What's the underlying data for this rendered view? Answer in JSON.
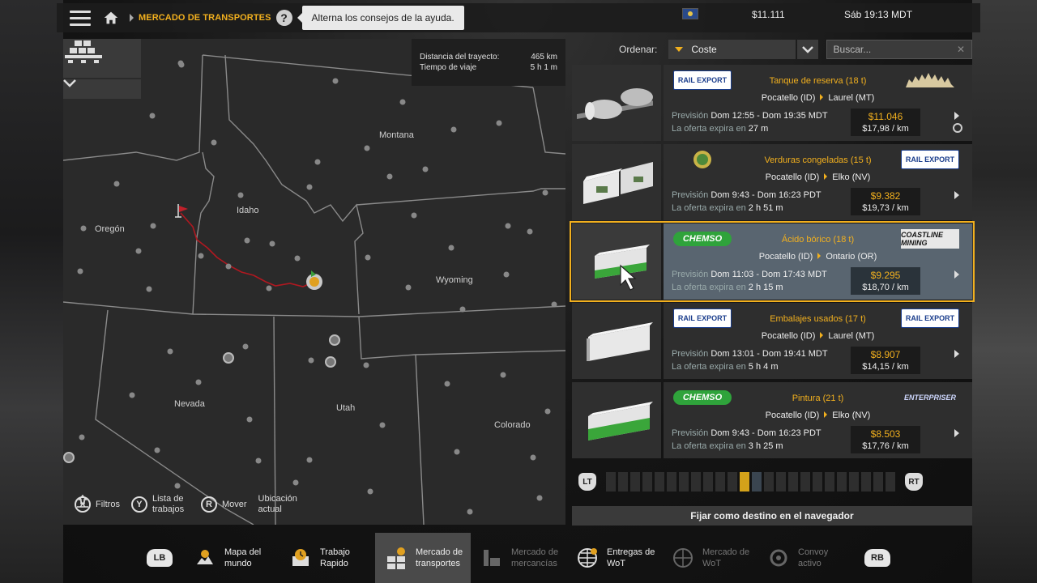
{
  "topbar": {
    "breadcrumb": "MERCADO DE TRANSPORTES",
    "help_label": "?",
    "tooltip": "Alterna los consejos de la ayuda.",
    "money": "$11.111",
    "clock": "Sáb 19:13 MDT"
  },
  "route_info": {
    "distance_label": "Distancia del trayecto:",
    "distance_value": "465 km",
    "time_label": "Tiempo de viaje",
    "time_value": "5 h 1 m"
  },
  "map": {
    "states": [
      "Montana",
      "Idaho",
      "Oregón",
      "Wyoming",
      "Nevada",
      "Utah",
      "Colorado"
    ],
    "controls": [
      {
        "key": "X",
        "label": "Filtros"
      },
      {
        "key": "Y",
        "label": "Lista de trabajos"
      },
      {
        "key": "R",
        "label": "Mover"
      },
      {
        "key": "",
        "label": "Ubicación actual"
      }
    ]
  },
  "sort": {
    "label": "Ordenar:",
    "value": "Coste",
    "search_placeholder": "Buscar..."
  },
  "jobs": [
    {
      "cargo": "Tanque de reserva (18 t)",
      "from": "Pocatello (ID)",
      "to": "Laurel (MT)",
      "forecast_label": "Previsión",
      "dates": "Dom 12:55 - Dom 19:35 MDT",
      "expires_label": "La oferta expira en",
      "expires": "27 m",
      "price": "$11.046",
      "per_km": "$17,98 / km",
      "logo_left": "RAIL EXPORT",
      "logo_right": "sawmill"
    },
    {
      "cargo": "Verduras congeladas (15 t)",
      "from": "Pocatello (ID)",
      "to": "Elko (NV)",
      "forecast_label": "Previsión",
      "dates": "Dom 9:43 - Dom 16:23 PDT",
      "expires_label": "La oferta expira en",
      "expires": "2 h 51 m",
      "price": "$9.382",
      "per_km": "$19,73 / km",
      "logo_left": "farm",
      "logo_right": "RAIL EXPORT"
    },
    {
      "cargo": "Ácido bórico (18 t)",
      "from": "Pocatello (ID)",
      "to": "Ontario (OR)",
      "forecast_label": "Previsión",
      "dates": "Dom 11:03 - Dom 17:43 MDT",
      "expires_label": "La oferta expira en",
      "expires": "2 h 15 m",
      "price": "$9.295",
      "per_km": "$18,70 / km",
      "logo_left": "CHEMSO",
      "logo_right": "COASTLINE MINING"
    },
    {
      "cargo": "Embalajes usados (17 t)",
      "from": "Pocatello (ID)",
      "to": "Laurel (MT)",
      "forecast_label": "Previsión",
      "dates": "Dom 13:01 - Dom 19:41 MDT",
      "expires_label": "La oferta expira en",
      "expires": "5 h 4 m",
      "price": "$8.907",
      "per_km": "$14,15 / km",
      "logo_left": "RAIL EXPORT",
      "logo_right": "RAIL EXPORT"
    },
    {
      "cargo": "Pintura (21 t)",
      "from": "Pocatello (ID)",
      "to": "Elko (NV)",
      "forecast_label": "Previsión",
      "dates": "Dom 9:43 - Dom 16:23 PDT",
      "expires_label": "La oferta expira en",
      "expires": "3 h 25 m",
      "price": "$8.503",
      "per_km": "$17,76 / km",
      "logo_left": "CHEMSO",
      "logo_right": "ENTERPRISER"
    }
  ],
  "pager": {
    "lt": "LT",
    "rt": "RT",
    "total": 24,
    "current": 11
  },
  "set_destination": "Fijar como destino en el navegador",
  "bottom_nav": {
    "lb": "LB",
    "rb": "RB",
    "items": [
      {
        "line1": "Mapa del",
        "line2": "mundo"
      },
      {
        "line1": "Trabajo",
        "line2": "Rapido"
      },
      {
        "line1": "Mercado de",
        "line2": "transportes"
      },
      {
        "line1": "Mercado de",
        "line2": "mercancías"
      },
      {
        "line1": "Entregas de",
        "line2": "WoT"
      },
      {
        "line1": "Mercado de",
        "line2": "WoT"
      },
      {
        "line1": "Convoy",
        "line2": "activo"
      }
    ]
  },
  "colors": {
    "accent": "#f2b01e",
    "selected_bg": "#596570",
    "route": "#b01820"
  }
}
